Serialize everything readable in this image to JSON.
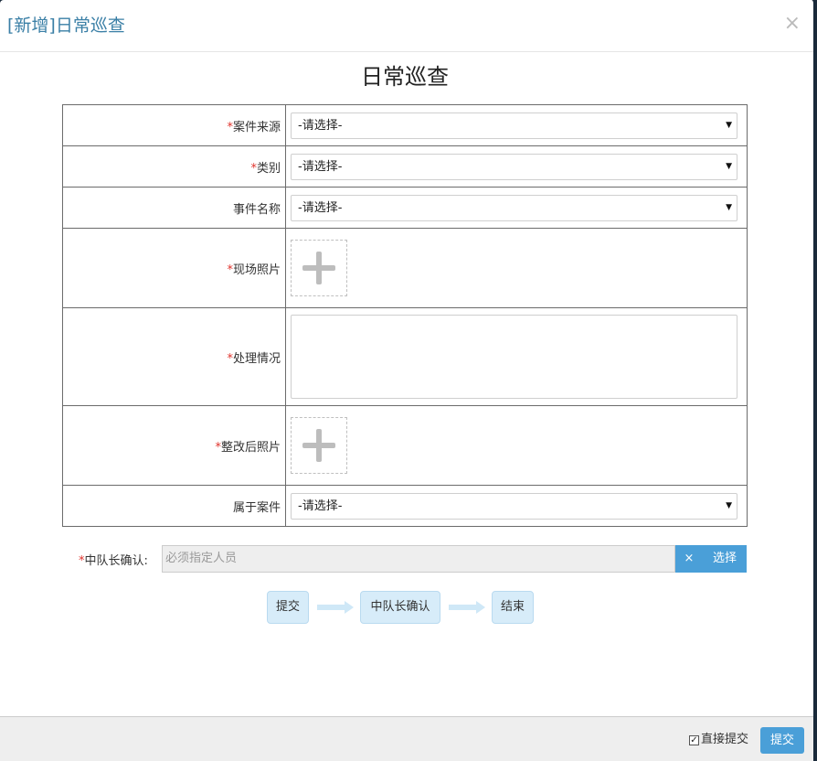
{
  "header": {
    "title": "[新增]日常巡查",
    "close_symbol": "×"
  },
  "form": {
    "title": "日常巡查",
    "required_mark": "*",
    "fields": {
      "case_source": {
        "label": "案件来源",
        "value": "-请选择-"
      },
      "category": {
        "label": "类别",
        "value": "-请选择-"
      },
      "event_name": {
        "label": "事件名称",
        "value": "-请选择-"
      },
      "site_photo": {
        "label": "现场照片"
      },
      "handling": {
        "label": "处理情况",
        "value": ""
      },
      "rectified_photo": {
        "label": "整改后照片"
      },
      "belongs_case": {
        "label": "属于案件",
        "value": "-请选择-"
      }
    }
  },
  "confirm": {
    "label": "中队长确认:",
    "placeholder": "必须指定人员",
    "clear_label": "×",
    "select_label": "选择"
  },
  "flow": {
    "steps": [
      "提交",
      "中队长确认",
      "结束"
    ]
  },
  "footer": {
    "direct_submit_label": "直接提交",
    "direct_submit_checked": true,
    "submit_label": "提交"
  },
  "colors": {
    "accent": "#4a9fd8",
    "title": "#3a7fa6",
    "required": "#e0332c",
    "flow_step_bg": "#d7ecf9",
    "flow_arrow": "#cfe8f7"
  }
}
